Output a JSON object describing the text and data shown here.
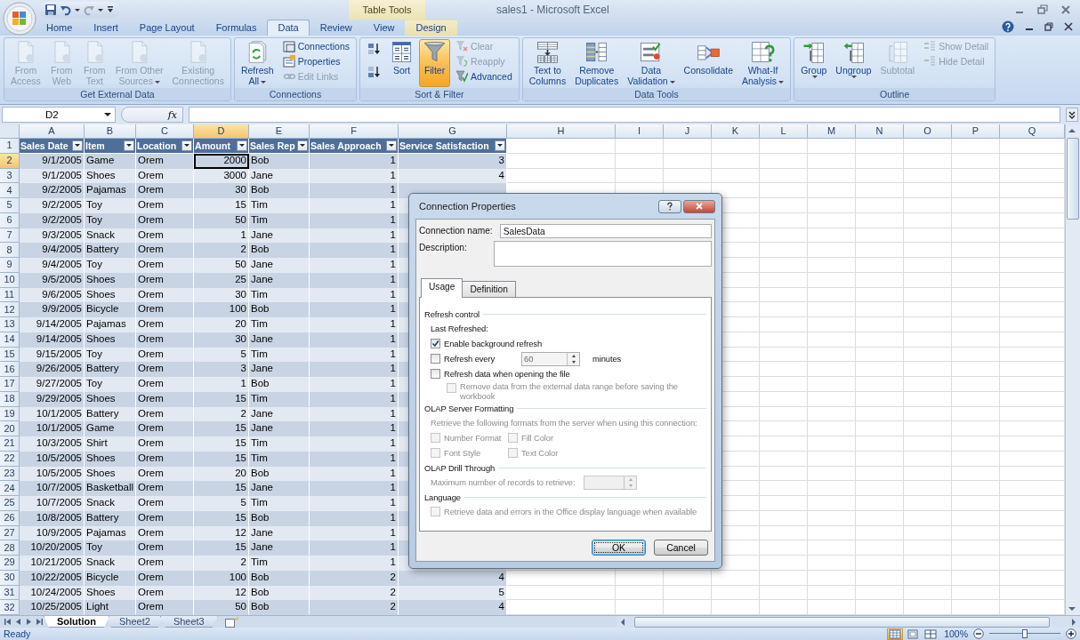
{
  "title_bar": {
    "context_group": "Table Tools",
    "title": "sales1 - Microsoft Excel"
  },
  "ribbon_tabs": [
    {
      "label": "Home",
      "kind": "normal",
      "selected": false
    },
    {
      "label": "Insert",
      "kind": "normal",
      "selected": false
    },
    {
      "label": "Page Layout",
      "kind": "normal",
      "selected": false
    },
    {
      "label": "Formulas",
      "kind": "normal",
      "selected": false
    },
    {
      "label": "Data",
      "kind": "normal",
      "selected": true
    },
    {
      "label": "Review",
      "kind": "normal",
      "selected": false
    },
    {
      "label": "View",
      "kind": "normal",
      "selected": false
    },
    {
      "label": "Design",
      "kind": "context",
      "selected": false
    }
  ],
  "ribbon_groups": [
    {
      "name": "Get External Data",
      "buttons": [
        {
          "kind": "large",
          "lines": [
            "From",
            "Access"
          ],
          "disabled": true,
          "on": false,
          "dropdown": false
        },
        {
          "kind": "large",
          "lines": [
            "From",
            "Web"
          ],
          "disabled": true,
          "on": false,
          "dropdown": false
        },
        {
          "kind": "large",
          "lines": [
            "From",
            "Text"
          ],
          "disabled": true,
          "on": false,
          "dropdown": false
        },
        {
          "kind": "large",
          "lines": [
            "From Other",
            "Sources"
          ],
          "disabled": true,
          "on": false,
          "dropdown": true
        },
        {
          "kind": "large",
          "lines": [
            "Existing",
            "Connections"
          ],
          "disabled": true,
          "on": false,
          "dropdown": false
        }
      ]
    },
    {
      "name": "Connections",
      "buttons": [
        {
          "kind": "large",
          "lines": [
            "Refresh",
            "All"
          ],
          "disabled": false,
          "on": false,
          "dropdown": true
        },
        {
          "kind": "small",
          "lines": [
            "Connections"
          ],
          "disabled": false,
          "on": false,
          "dropdown": false
        },
        {
          "kind": "small",
          "lines": [
            "Properties"
          ],
          "disabled": false,
          "on": false,
          "dropdown": false
        },
        {
          "kind": "small",
          "lines": [
            "Edit Links"
          ],
          "disabled": true,
          "on": false,
          "dropdown": false
        }
      ]
    },
    {
      "name": "Sort & Filter",
      "buttons": [
        {
          "kind": "icon",
          "disabled": false,
          "on": false,
          "dropdown": false
        },
        {
          "kind": "icon",
          "disabled": false,
          "on": false,
          "dropdown": false
        },
        {
          "kind": "large",
          "lines": [
            "Sort"
          ],
          "disabled": false,
          "on": false,
          "dropdown": false
        },
        {
          "kind": "large",
          "lines": [
            "Filter"
          ],
          "disabled": false,
          "on": true,
          "dropdown": false
        },
        {
          "kind": "small",
          "lines": [
            "Clear"
          ],
          "disabled": true,
          "on": false,
          "dropdown": false
        },
        {
          "kind": "small",
          "lines": [
            "Reapply"
          ],
          "disabled": true,
          "on": false,
          "dropdown": false
        },
        {
          "kind": "small",
          "lines": [
            "Advanced"
          ],
          "disabled": false,
          "on": false,
          "dropdown": false
        }
      ]
    },
    {
      "name": "Data Tools",
      "buttons": [
        {
          "kind": "large",
          "lines": [
            "Text to",
            "Columns"
          ],
          "disabled": false,
          "on": false,
          "dropdown": false
        },
        {
          "kind": "large",
          "lines": [
            "Remove",
            "Duplicates"
          ],
          "disabled": false,
          "on": false,
          "dropdown": false
        },
        {
          "kind": "large",
          "lines": [
            "Data",
            "Validation"
          ],
          "disabled": false,
          "on": false,
          "dropdown": true
        },
        {
          "kind": "large",
          "lines": [
            "Consolidate"
          ],
          "disabled": false,
          "on": false,
          "dropdown": false
        },
        {
          "kind": "large",
          "lines": [
            "What-If",
            "Analysis"
          ],
          "disabled": false,
          "on": false,
          "dropdown": true
        }
      ]
    },
    {
      "name": "Outline",
      "buttons": [
        {
          "kind": "large",
          "lines": [
            "Group"
          ],
          "disabled": false,
          "on": false,
          "dropdown": true
        },
        {
          "kind": "large",
          "lines": [
            "Ungroup"
          ],
          "disabled": false,
          "on": false,
          "dropdown": true
        },
        {
          "kind": "large",
          "lines": [
            "Subtotal"
          ],
          "disabled": true,
          "on": false,
          "dropdown": false
        },
        {
          "kind": "small",
          "lines": [
            "Show Detail"
          ],
          "disabled": true,
          "on": false,
          "dropdown": false
        },
        {
          "kind": "small",
          "lines": [
            "Hide Detail"
          ],
          "disabled": true,
          "on": false,
          "dropdown": false
        }
      ]
    }
  ],
  "formula_bar": {
    "name_box": "D2",
    "function_label": "fx"
  },
  "grid": {
    "columns": [
      {
        "label": "A",
        "selected": false
      },
      {
        "label": "B",
        "selected": false
      },
      {
        "label": "C",
        "selected": false
      },
      {
        "label": "D",
        "selected": true
      },
      {
        "label": "E",
        "selected": false
      },
      {
        "label": "F",
        "selected": false
      },
      {
        "label": "G",
        "selected": false
      },
      {
        "label": "H",
        "selected": false
      },
      {
        "label": "I",
        "selected": false
      },
      {
        "label": "J",
        "selected": false
      },
      {
        "label": "K",
        "selected": false
      },
      {
        "label": "L",
        "selected": false
      },
      {
        "label": "M",
        "selected": false
      },
      {
        "label": "N",
        "selected": false
      },
      {
        "label": "O",
        "selected": false
      },
      {
        "label": "P",
        "selected": false
      },
      {
        "label": "Q",
        "selected": false
      }
    ],
    "rows": [
      {
        "number": "1",
        "kind": "header",
        "selected": false,
        "cells": [
          "Sales Date",
          "Item",
          "Location",
          "Amount",
          "Sales Rep",
          "Sales Approach",
          "Service Satisfaction"
        ]
      },
      {
        "number": "2",
        "kind": "data",
        "selected": true,
        "cells": [
          "9/1/2005",
          "Game",
          "Orem",
          "2000",
          "Bob",
          "1",
          "3"
        ]
      },
      {
        "number": "3",
        "kind": "data",
        "selected": false,
        "cells": [
          "9/1/2005",
          "Shoes",
          "Orem",
          "3000",
          "Jane",
          "1",
          "4"
        ]
      },
      {
        "number": "4",
        "kind": "data",
        "selected": false,
        "cells": [
          "9/2/2005",
          "Pajamas",
          "Orem",
          "30",
          "Bob",
          "1"
        ]
      },
      {
        "number": "5",
        "kind": "data",
        "selected": false,
        "cells": [
          "9/2/2005",
          "Toy",
          "Orem",
          "15",
          "Tim",
          "1"
        ]
      },
      {
        "number": "6",
        "kind": "data",
        "selected": false,
        "cells": [
          "9/2/2005",
          "Toy",
          "Orem",
          "50",
          "Tim",
          "1"
        ]
      },
      {
        "number": "7",
        "kind": "data",
        "selected": false,
        "cells": [
          "9/3/2005",
          "Snack",
          "Orem",
          "1",
          "Jane",
          "1"
        ]
      },
      {
        "number": "8",
        "kind": "data",
        "selected": false,
        "cells": [
          "9/4/2005",
          "Battery",
          "Orem",
          "2",
          "Bob",
          "1"
        ]
      },
      {
        "number": "9",
        "kind": "data",
        "selected": false,
        "cells": [
          "9/4/2005",
          "Toy",
          "Orem",
          "50",
          "Jane",
          "1"
        ]
      },
      {
        "number": "10",
        "kind": "data",
        "selected": false,
        "cells": [
          "9/5/2005",
          "Shoes",
          "Orem",
          "25",
          "Jane",
          "1"
        ]
      },
      {
        "number": "11",
        "kind": "data",
        "selected": false,
        "cells": [
          "9/6/2005",
          "Shoes",
          "Orem",
          "30",
          "Tim",
          "1"
        ]
      },
      {
        "number": "12",
        "kind": "data",
        "selected": false,
        "cells": [
          "9/9/2005",
          "Bicycle",
          "Orem",
          "100",
          "Bob",
          "1"
        ]
      },
      {
        "number": "13",
        "kind": "data",
        "selected": false,
        "cells": [
          "9/14/2005",
          "Pajamas",
          "Orem",
          "20",
          "Tim",
          "1"
        ]
      },
      {
        "number": "14",
        "kind": "data",
        "selected": false,
        "cells": [
          "9/14/2005",
          "Shoes",
          "Orem",
          "30",
          "Jane",
          "1"
        ]
      },
      {
        "number": "15",
        "kind": "data",
        "selected": false,
        "cells": [
          "9/15/2005",
          "Toy",
          "Orem",
          "5",
          "Tim",
          "1"
        ]
      },
      {
        "number": "16",
        "kind": "data",
        "selected": false,
        "cells": [
          "9/26/2005",
          "Battery",
          "Orem",
          "3",
          "Jane",
          "1"
        ]
      },
      {
        "number": "17",
        "kind": "data",
        "selected": false,
        "cells": [
          "9/27/2005",
          "Toy",
          "Orem",
          "1",
          "Bob",
          "1"
        ]
      },
      {
        "number": "18",
        "kind": "data",
        "selected": false,
        "cells": [
          "9/29/2005",
          "Shoes",
          "Orem",
          "15",
          "Tim",
          "1"
        ]
      },
      {
        "number": "19",
        "kind": "data",
        "selected": false,
        "cells": [
          "10/1/2005",
          "Battery",
          "Orem",
          "2",
          "Jane",
          "1"
        ]
      },
      {
        "number": "20",
        "kind": "data",
        "selected": false,
        "cells": [
          "10/1/2005",
          "Game",
          "Orem",
          "15",
          "Jane",
          "1"
        ]
      },
      {
        "number": "21",
        "kind": "data",
        "selected": false,
        "cells": [
          "10/3/2005",
          "Shirt",
          "Orem",
          "15",
          "Tim",
          "1"
        ]
      },
      {
        "number": "22",
        "kind": "data",
        "selected": false,
        "cells": [
          "10/5/2005",
          "Shoes",
          "Orem",
          "15",
          "Tim",
          "1"
        ]
      },
      {
        "number": "23",
        "kind": "data",
        "selected": false,
        "cells": [
          "10/5/2005",
          "Shoes",
          "Orem",
          "20",
          "Bob",
          "1"
        ]
      },
      {
        "number": "24",
        "kind": "data",
        "selected": false,
        "cells": [
          "10/7/2005",
          "Basketball",
          "Orem",
          "15",
          "Jane",
          "1"
        ]
      },
      {
        "number": "25",
        "kind": "data",
        "selected": false,
        "cells": [
          "10/7/2005",
          "Snack",
          "Orem",
          "5",
          "Tim",
          "1"
        ]
      },
      {
        "number": "26",
        "kind": "data",
        "selected": false,
        "cells": [
          "10/8/2005",
          "Battery",
          "Orem",
          "15",
          "Bob",
          "1"
        ]
      },
      {
        "number": "27",
        "kind": "data",
        "selected": false,
        "cells": [
          "10/9/2005",
          "Pajamas",
          "Orem",
          "12",
          "Jane",
          "1"
        ]
      },
      {
        "number": "28",
        "kind": "data",
        "selected": false,
        "cells": [
          "10/20/2005",
          "Toy",
          "Orem",
          "15",
          "Jane",
          "1"
        ]
      },
      {
        "number": "29",
        "kind": "data",
        "selected": false,
        "cells": [
          "10/21/2005",
          "Snack",
          "Orem",
          "2",
          "Tim",
          "1"
        ]
      },
      {
        "number": "30",
        "kind": "data",
        "selected": false,
        "cells": [
          "10/22/2005",
          "Bicycle",
          "Orem",
          "100",
          "Bob",
          "2",
          "4"
        ]
      },
      {
        "number": "31",
        "kind": "data",
        "selected": false,
        "cells": [
          "10/24/2005",
          "Shoes",
          "Orem",
          "12",
          "Bob",
          "2",
          "5"
        ]
      },
      {
        "number": "32",
        "kind": "data",
        "selected": false,
        "cells": [
          "10/25/2005",
          "Light",
          "Orem",
          "50",
          "Bob",
          "2",
          "4"
        ]
      }
    ]
  },
  "dialog": {
    "title": "Connection Properties",
    "fields": [
      {
        "label": "Connection name:",
        "value": "SalesData"
      },
      {
        "label": "Description:"
      }
    ],
    "tabs": [
      {
        "label": "Usage",
        "selected": true
      },
      {
        "label": "Definition",
        "selected": false
      }
    ],
    "sections": [
      {
        "title": "Refresh control",
        "items": [
          {
            "kind": "text",
            "label": "Last Refreshed:",
            "disabled": false
          },
          {
            "kind": "checkbox",
            "label": "Enable background refresh",
            "checked": true,
            "disabled": false
          },
          {
            "kind": "spinner-checkbox",
            "label": "Refresh every",
            "checked": false,
            "disabled": false,
            "value": "60",
            "unit": "minutes"
          },
          {
            "kind": "checkbox",
            "label": "Refresh data when opening the file",
            "checked": false,
            "disabled": false,
            "children": [
              {
                "kind": "checkbox",
                "label": "Remove data from the external data range before saving the workbook",
                "checked": false,
                "disabled": true
              }
            ]
          }
        ]
      },
      {
        "title": "OLAP Server Formatting",
        "items": [
          {
            "kind": "text",
            "label": "Retrieve the following formats from the server when using this connection:",
            "disabled": true
          },
          {
            "kind": "checkbox-row",
            "items": [
              {
                "label": "Number Format",
                "checked": false,
                "disabled": true
              },
              {
                "label": "Fill Color",
                "checked": false,
                "disabled": true
              }
            ]
          },
          {
            "kind": "checkbox-row",
            "items": [
              {
                "label": "Font Style",
                "checked": false,
                "disabled": true
              },
              {
                "label": "Text Color",
                "checked": false,
                "disabled": true
              }
            ]
          }
        ]
      },
      {
        "title": "OLAP Drill Through",
        "items": [
          {
            "kind": "spinner",
            "label": "Maximum number of records to retrieve:",
            "disabled": true
          }
        ]
      },
      {
        "title": "Language",
        "items": [
          {
            "kind": "checkbox",
            "label": "Retrieve data and errors in the Office display language when available",
            "checked": false,
            "disabled": true
          }
        ]
      }
    ],
    "buttons": [
      {
        "label": "OK",
        "default": true
      },
      {
        "label": "Cancel",
        "default": false
      }
    ]
  },
  "sheet_tabs": [
    {
      "label": "Solution",
      "selected": true
    },
    {
      "label": "Sheet2",
      "selected": false
    },
    {
      "label": "Sheet3",
      "selected": false
    }
  ],
  "status_bar": {
    "status": "Ready",
    "view_buttons": [
      {
        "selected": true
      },
      {
        "selected": false
      },
      {
        "selected": false
      }
    ],
    "zoom": {
      "label": "100%",
      "level": 0.5
    }
  }
}
